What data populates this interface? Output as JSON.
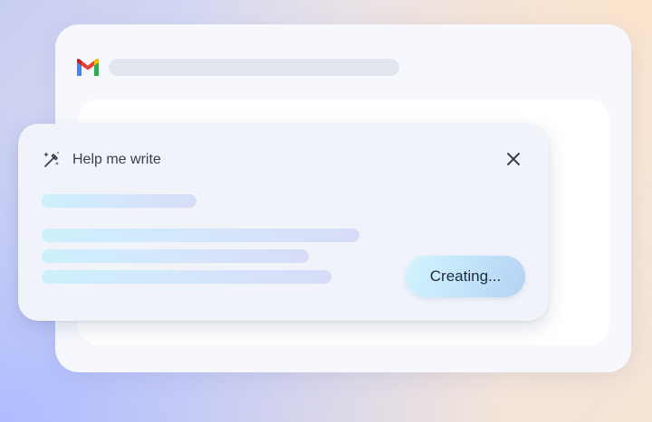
{
  "help_me_write": {
    "title": "Help me write",
    "status_button_label": "Creating..."
  },
  "icons": {
    "logo": "gmail-logo",
    "pencil": "magic-pencil-icon",
    "close": "close-icon"
  },
  "colors": {
    "gmail_red": "#ea4335",
    "gmail_blue": "#4285f4",
    "gmail_green": "#34a853",
    "gmail_yellow": "#fbbc04",
    "skeleton_accent": "#cdf0fc"
  }
}
